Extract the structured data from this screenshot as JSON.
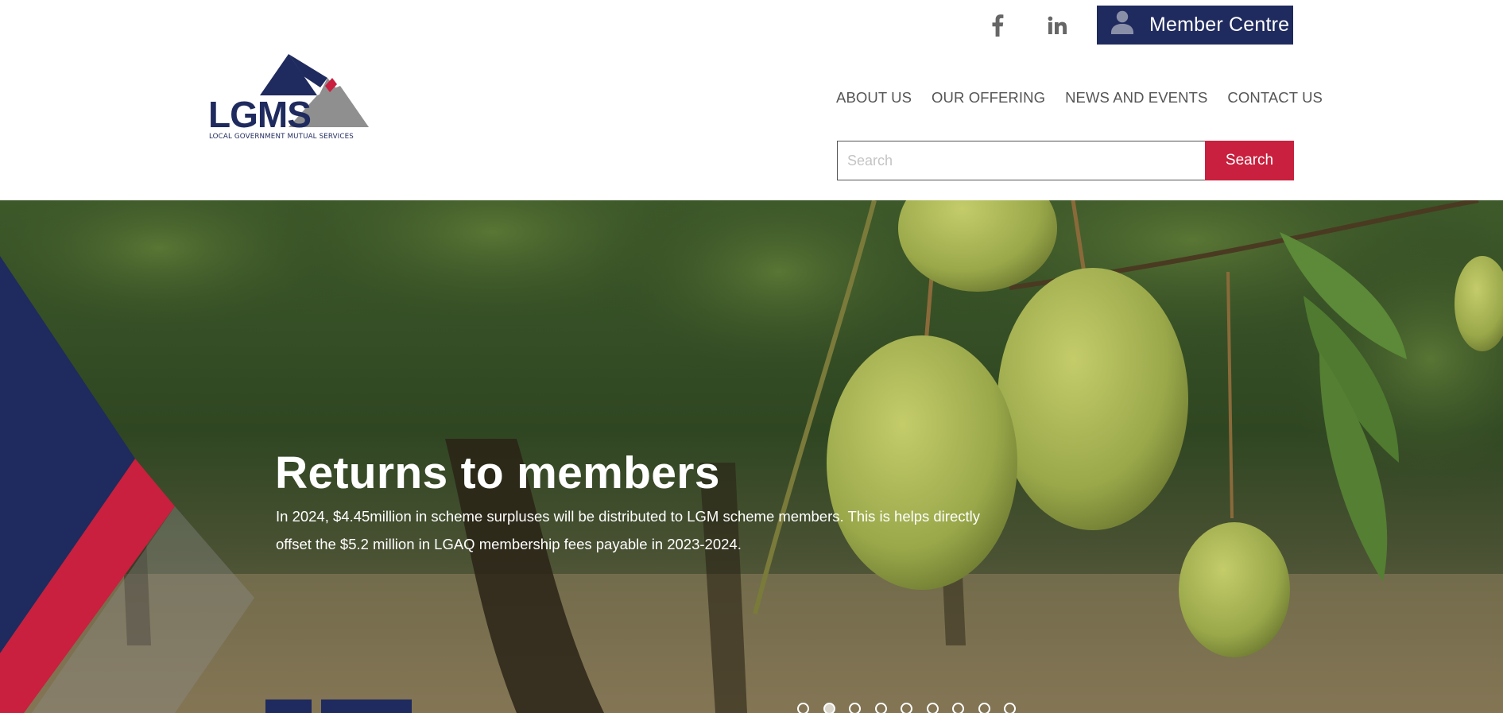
{
  "header": {
    "social": [
      {
        "icon": "facebook-icon"
      },
      {
        "icon": "linkedin-icon"
      }
    ],
    "member_centre_label": "Member Centre",
    "logo": {
      "wordmark": "LGMS",
      "tagline": "LOCAL GOVERNMENT MUTUAL SERVICES"
    }
  },
  "nav": {
    "items": [
      {
        "label": "ABOUT US"
      },
      {
        "label": "OUR OFFERING"
      },
      {
        "label": "NEWS AND EVENTS"
      },
      {
        "label": "CONTACT US"
      }
    ]
  },
  "search": {
    "placeholder": "Search",
    "button_label": "Search"
  },
  "hero": {
    "title": "Returns to members",
    "text": "In 2024, $4.45million in scheme surpluses will be distributed to LGM scheme members. This is helps directly offset the $5.2 million in LGAQ membership fees payable in 2023-2024.",
    "slide_count": 9,
    "active_slide": 2
  },
  "colors": {
    "navy": "#1f2a5e",
    "red": "#c8203e",
    "grey": "#8a8a8a"
  }
}
